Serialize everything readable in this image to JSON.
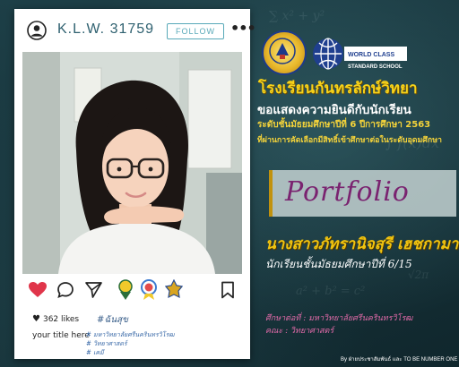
{
  "post": {
    "username": "K.L.W. 31759",
    "follow_label": "FOLLOW",
    "likes": "362 likes",
    "caption_tag": "#ฉันสุข",
    "title_placeholder": "your title here",
    "caption_lines": [
      "# มหาวิทยาลัยศรีนครินทรวิโรฒ",
      "# วิทยาศาสตร์",
      "# เคมี"
    ]
  },
  "school": {
    "name": "โรงเรียนกันทรลักษ์วิทยา",
    "logo2_text": "WORLD CLASS STANDARD SCHOOL"
  },
  "announcement": {
    "congrats": "ขอแสดงความยินดีกับนักเรียน",
    "level": "ระดับชั้นมัธยมศึกษาปีที่ 6 ปีการศึกษา 2563",
    "selected": "ที่ผ่านการคัดเลือกมีสิทธิ์เข้าศึกษาต่อในระดับอุดมศึกษา"
  },
  "portfolio_label": "Portfolio",
  "student": {
    "name": "นางสาวภัทรานิจสุรี เฮชกามา",
    "class_line": "นักเรียนชั้นมัธยมศึกษาปีที่ 6/15",
    "faculty_line": "ศึกษาต่อที่ : มหาวิทยาลัยศรีนครินทรวิโรฒ",
    "major_line": "คณะ : วิทยาศาสตร์"
  },
  "credit": "By ฝ่ายประชาสัมพันธ์ และ TO BE NUMBER ONE",
  "colors": {
    "background": "#16323a",
    "school_name": "#f6d21a",
    "portfolio_text": "#7a2370",
    "like_heart": "#e0354a"
  }
}
